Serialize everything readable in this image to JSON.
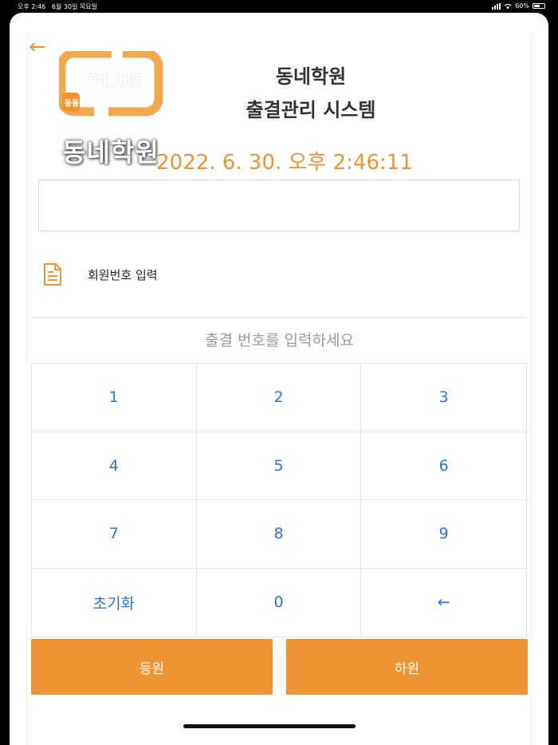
{
  "status_bar": {
    "time": "오후 2:46",
    "date": "6월 30일 목요일",
    "battery": "60%"
  },
  "logo": {
    "badge": "PLUS",
    "small": "동동",
    "name": "동네학원"
  },
  "header": {
    "title_line1": "동네학원",
    "title_line2": "출결관리 시스템",
    "datetime": "2022. 6. 30. 오후 2:46:11"
  },
  "member": {
    "label": "회원번호 입력"
  },
  "input": {
    "value": ""
  },
  "hint": "출결 번호를 입력하세요",
  "keypad": {
    "keys": [
      "1",
      "2",
      "3",
      "4",
      "5",
      "6",
      "7",
      "8",
      "9",
      "초기화",
      "0",
      "←"
    ]
  },
  "buttons": {
    "check_in": "등원",
    "check_out": "하원"
  },
  "colors": {
    "accent": "#ee9432",
    "key_text": "#2b73e0"
  },
  "icons": {
    "back": "back-arrow-icon",
    "member": "document-icon"
  }
}
